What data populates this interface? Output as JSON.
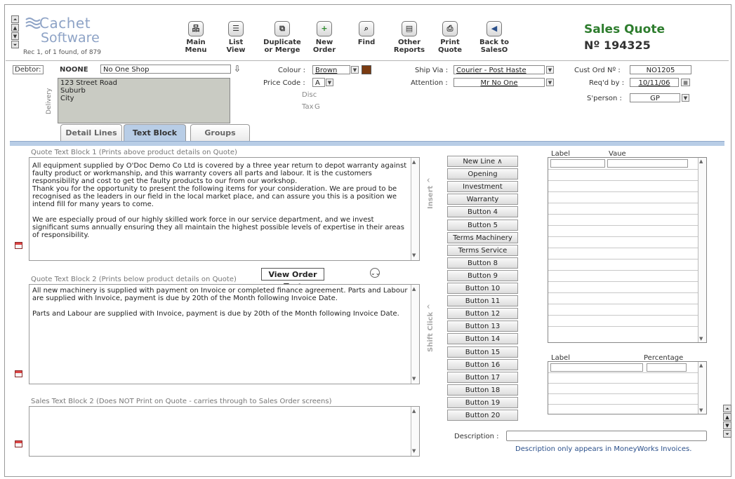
{
  "brand": {
    "line1": "Cachet",
    "line2": "Software",
    "record_status": "Rec 1, of 1 found, of 879"
  },
  "toolbar": [
    {
      "label1": "Main",
      "label2": "Menu",
      "icon": "sitemap-icon",
      "glyph": "品"
    },
    {
      "label1": "List",
      "label2": "View",
      "icon": "list-icon",
      "glyph": "☰"
    },
    {
      "label1": "Duplicate",
      "label2": "or Merge",
      "icon": "duplicate-icon",
      "glyph": "⧉"
    },
    {
      "label1": "New",
      "label2": "Order",
      "icon": "plus-icon",
      "glyph": "+"
    },
    {
      "label1": "Find",
      "label2": "",
      "icon": "magnifier-icon",
      "glyph": "⌕"
    },
    {
      "label1": "Other",
      "label2": "Reports",
      "icon": "document-icon",
      "glyph": "▤"
    },
    {
      "label1": "Print",
      "label2": "Quote",
      "icon": "printer-icon",
      "glyph": "⎙"
    },
    {
      "label1": "Back to",
      "label2": "SalesO",
      "icon": "back-arrow-icon",
      "glyph": "◀"
    }
  ],
  "title": {
    "heading": "Sales Quote",
    "number": "Nº 194325"
  },
  "debtor": {
    "label": "Debtor:",
    "code": "NOONE",
    "name": "No One Shop",
    "download_icon": "⇩"
  },
  "delivery": {
    "label": "Delivery",
    "line1": "123 Street Road",
    "line2": "Suburb",
    "line3": "City"
  },
  "mid_fields": {
    "colour_label": "Colour :",
    "colour_value": "Brown",
    "colour_swatch": "#7a3b12",
    "price_code_label": "Price Code :",
    "price_code_value": "A",
    "disc_label": "Disc",
    "tax_label": "Tax",
    "tax_value": "G"
  },
  "shipping": {
    "ship_via_label": "Ship Via :",
    "ship_via_value": "Courier - Post Haste",
    "attention_label": "Attention :",
    "attention_value": "Mr No One"
  },
  "order": {
    "cust_ord_label": "Cust Ord Nº :",
    "cust_ord_value": "NO1205",
    "reqd_by_label": "Req'd by :",
    "reqd_by_value": "10/11/06",
    "sperson_label": "S'person :",
    "sperson_value": "GP"
  },
  "tabs": [
    "Detail Lines",
    "Text Block",
    "Groups"
  ],
  "quote_block1": {
    "title": "Quote Text Block 1 (Prints above product details on Quote)",
    "para1": "All equipment supplied by O'Doc Demo Co Ltd is covered by a three year return to depot warranty against faulty product or workmanship, and this warranty covers all parts and labour.  It is the customers responsibility and cost to get the faulty products to our from our workshop.\nThank you for the opportunity to present the following items for your consideration.  We are proud to be recognised as the leaders in our field in the local market place, and can assure you this is a position we intend fill for many years to come.",
    "para2": "We are especially proud of our highly skilled work force in our service department, and we invest significant sums annually ensuring they all maintain the highest possible levels of expertise in their areas of responsibility."
  },
  "view_order_text": "View Order Text",
  "quote_block2": {
    "title": "Quote Text Block 2 (Prints below product details on Quote)",
    "para1": "All new machinery is supplied with payment on Invoice or completed finance agreement.  Parts and Labour are supplied with Invoice, payment is due by 20th of the Month following Invoice Date.",
    "para2": "Parts and Labour are supplied with Invoice, payment is due by 20th of the Month following Invoice Date."
  },
  "sales_block2": {
    "title": "Sales Text Block 2 (Does NOT Print on Quote - carries through to Sales Order screens)",
    "text": ""
  },
  "side_labels": {
    "insert": "Insert ^",
    "shift_click": "Shift Click ^"
  },
  "insert_buttons": [
    "New Line ∧",
    "Opening",
    "Investment",
    "Warranty",
    "Button 4",
    "Button 5",
    "Terms Machinery",
    "Terms Service",
    "Button 8",
    "Button 9",
    "Button 10",
    "Button 11",
    "Button 12",
    "Button 13",
    "Button 14",
    "Button 15",
    "Button 16",
    "Button 17",
    "Button 18",
    "Button 19",
    "Button 20"
  ],
  "grid1": {
    "col1": "Label",
    "col2": "Vaue"
  },
  "grid2": {
    "col1": "Label",
    "col2": "Percentage"
  },
  "description": {
    "label": "Description :",
    "value": "",
    "note": "Description only appears in MoneyWorks Invoices."
  }
}
